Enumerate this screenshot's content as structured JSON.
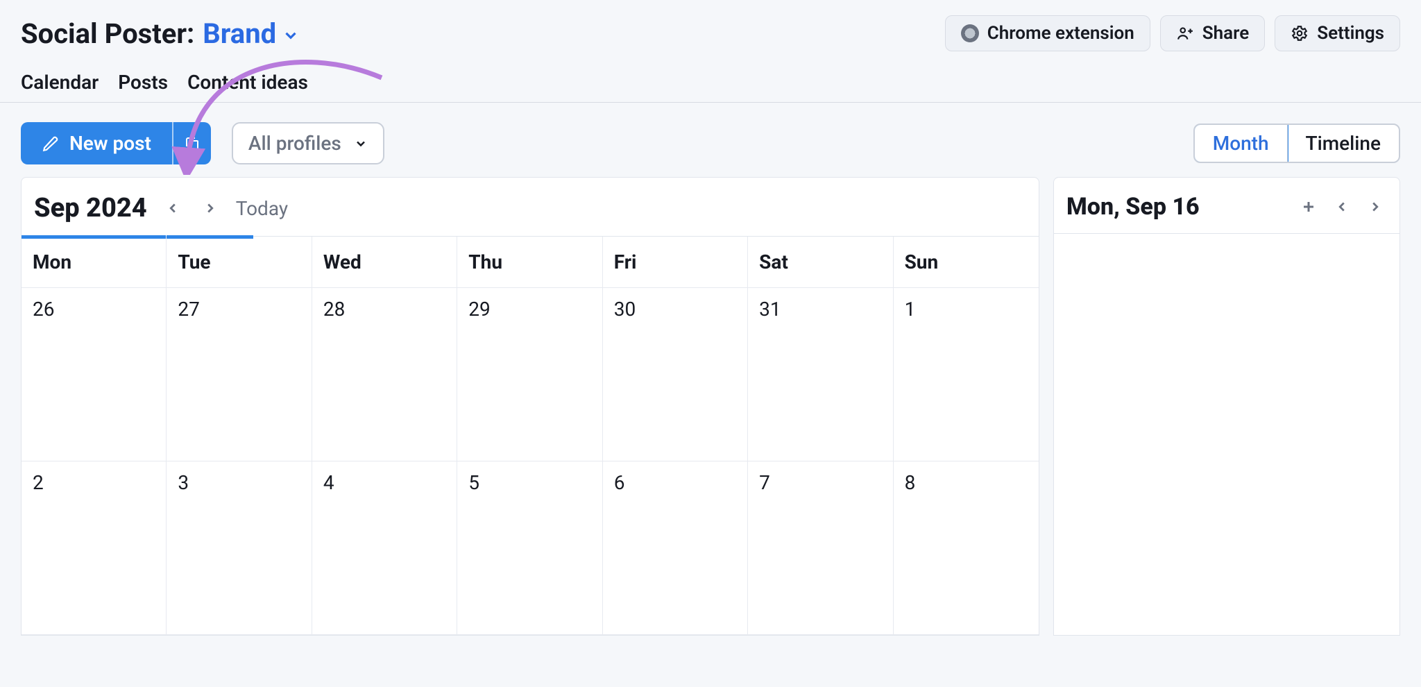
{
  "header": {
    "app_title": "Social Poster:",
    "brand_label": "Brand",
    "chrome_ext": "Chrome extension",
    "share": "Share",
    "settings": "Settings"
  },
  "tabs": {
    "calendar": "Calendar",
    "posts": "Posts",
    "content_ideas": "Content ideas"
  },
  "toolbar": {
    "new_post": "New post",
    "profiles": "All profiles",
    "month": "Month",
    "timeline": "Timeline"
  },
  "calendar": {
    "month_label": "Sep 2024",
    "today": "Today",
    "days": [
      "Mon",
      "Tue",
      "Wed",
      "Thu",
      "Fri",
      "Sat",
      "Sun"
    ],
    "rows": [
      [
        "26",
        "27",
        "28",
        "29",
        "30",
        "31",
        "1"
      ],
      [
        "2",
        "3",
        "4",
        "5",
        "6",
        "7",
        "8"
      ]
    ]
  },
  "sidepanel": {
    "date_label": "Mon, Sep 16"
  }
}
